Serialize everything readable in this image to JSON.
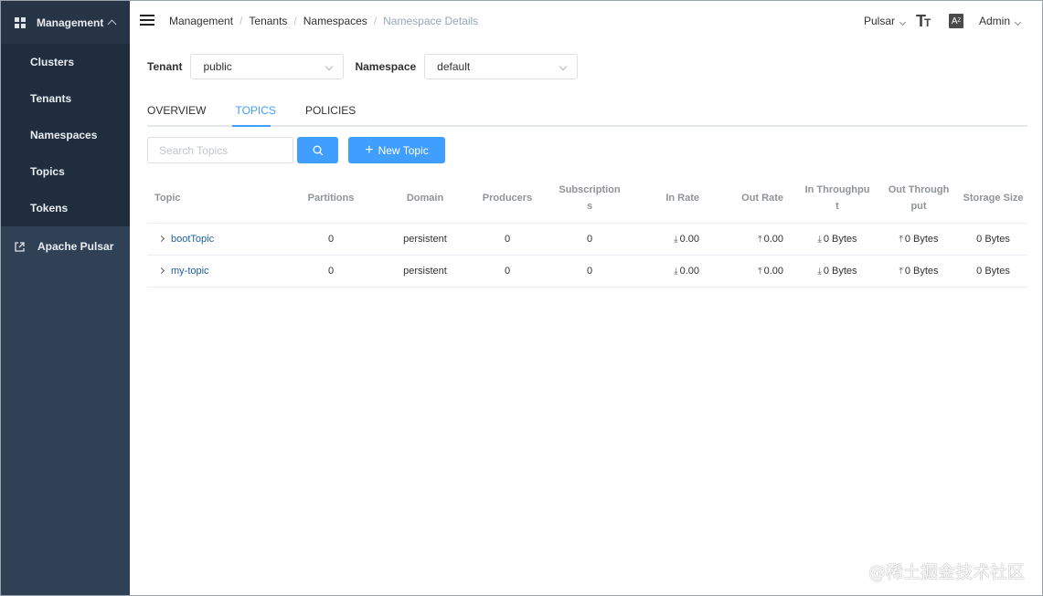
{
  "sidebar": {
    "group_label": "Management",
    "items": [
      {
        "label": "Clusters"
      },
      {
        "label": "Tenants"
      },
      {
        "label": "Namespaces"
      },
      {
        "label": "Topics"
      },
      {
        "label": "Tokens"
      }
    ],
    "external_label": "Apache Pulsar"
  },
  "topbar": {
    "breadcrumbs": [
      "Management",
      "Tenants",
      "Namespaces",
      "Namespace Details"
    ],
    "environment": "Pulsar",
    "size_icon": "text-size-icon",
    "lang_icon": "language-icon",
    "user": "Admin"
  },
  "filters": {
    "tenant_label": "Tenant",
    "tenant_value": "public",
    "namespace_label": "Namespace",
    "namespace_value": "default"
  },
  "tabs": [
    {
      "label": "OVERVIEW"
    },
    {
      "label": "TOPICS",
      "active": true
    },
    {
      "label": "POLICIES"
    }
  ],
  "toolbar": {
    "search_placeholder": "Search Topics",
    "new_topic_label": "New Topic"
  },
  "table": {
    "headers": {
      "topic": "Topic",
      "partitions": "Partitions",
      "domain": "Domain",
      "producers": "Producers",
      "subscriptions_a": "Subscription",
      "subscriptions_b": "s",
      "in_rate": "In Rate",
      "out_rate": "Out Rate",
      "in_throughput_a": "In Throughpu",
      "in_throughput_b": "t",
      "out_throughput_a": "Out Through",
      "out_throughput_b": "put",
      "storage_size": "Storage Size"
    },
    "rows": [
      {
        "topic": "bootTopic",
        "partitions": "0",
        "domain": "persistent",
        "producers": "0",
        "subscriptions": "0",
        "in_rate": "0.00",
        "out_rate": "0.00",
        "in_throughput": "0 Bytes",
        "out_throughput": "0 Bytes",
        "storage_size": "0 Bytes"
      },
      {
        "topic": "my-topic",
        "partitions": "0",
        "domain": "persistent",
        "producers": "0",
        "subscriptions": "0",
        "in_rate": "0.00",
        "out_rate": "0.00",
        "in_throughput": "0 Bytes",
        "out_throughput": "0 Bytes",
        "storage_size": "0 Bytes"
      }
    ]
  },
  "watermark": "@稀土掘金技术社区",
  "colors": {
    "sidebar_bg": "#304156",
    "sidebar_sub_bg": "#1f2d3d",
    "accent": "#409eff"
  }
}
